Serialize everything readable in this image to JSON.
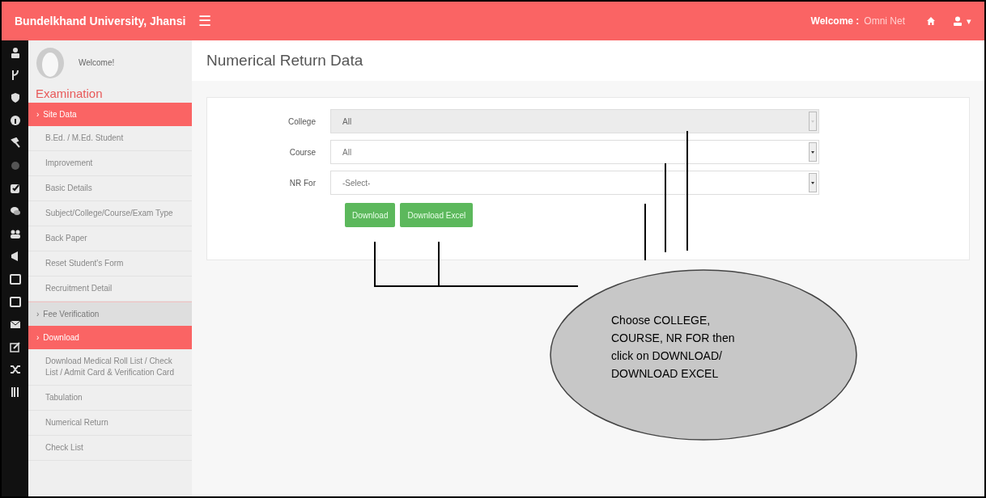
{
  "header": {
    "title": "Bundelkhand University, Jhansi",
    "menu_glyph": "☰",
    "welcome_label": "Welcome :",
    "user_name": "Omni Net",
    "user_caret": "▾"
  },
  "sidebar": {
    "greeting": "Welcome!",
    "heading": "Examination",
    "items": [
      {
        "kind": "section",
        "label": "Site Data",
        "selected": true,
        "marker": "›"
      },
      {
        "kind": "item",
        "label": "B.Ed. / M.Ed. Student"
      },
      {
        "kind": "item",
        "label": "Improvement"
      },
      {
        "kind": "item",
        "label": "Basic Details"
      },
      {
        "kind": "item",
        "label": "Subject/College/Course/Exam Type"
      },
      {
        "kind": "item",
        "label": "Back Paper"
      },
      {
        "kind": "item",
        "label": "Reset Student's Form"
      },
      {
        "kind": "item",
        "label": "Recruitment Detail"
      },
      {
        "kind": "section",
        "label": "Fee Verification",
        "selected": false,
        "marker": "›"
      },
      {
        "kind": "section",
        "label": "Download",
        "selected": true,
        "marker": "›"
      },
      {
        "kind": "item",
        "label": "Download Medical Roll List / Check List / Admit Card & Verification Card"
      },
      {
        "kind": "item",
        "label": "Tabulation"
      },
      {
        "kind": "item",
        "label": "Numerical Return"
      },
      {
        "kind": "item",
        "label": "Check List"
      }
    ]
  },
  "page_title": "Numerical Return Data",
  "form": {
    "fields": [
      {
        "label": "College",
        "value": "All",
        "disabled": true
      },
      {
        "label": "Course",
        "value": "All",
        "disabled": false
      },
      {
        "label": "NR For",
        "value": "-Select-",
        "disabled": false
      }
    ],
    "buttons": [
      "Download",
      "Download Excel"
    ]
  },
  "callout": {
    "text": "Choose COLLEGE, COURSE, NR FOR then click on DOWNLOAD/ DOWNLOAD EXCEL"
  }
}
